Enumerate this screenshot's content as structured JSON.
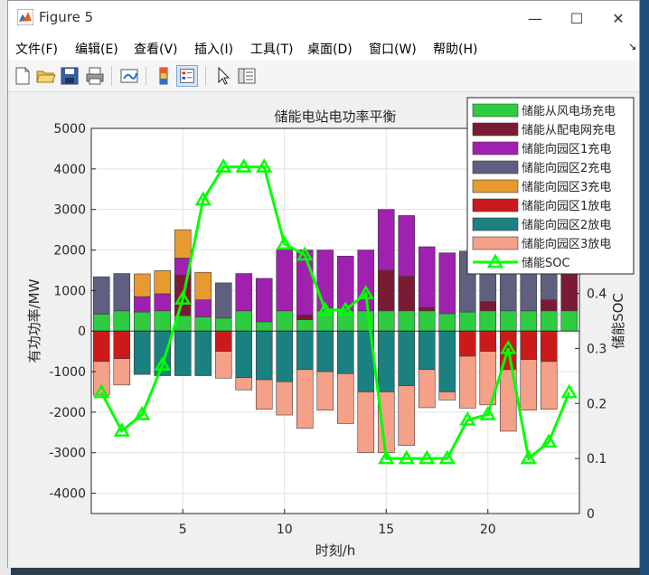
{
  "window": {
    "title": "Figure 5",
    "controls": {
      "minimize": "—",
      "maximize": "☐",
      "close": "✕"
    }
  },
  "menu": [
    {
      "label": "文件(F)"
    },
    {
      "label": "编辑(E)"
    },
    {
      "label": "查看(V)"
    },
    {
      "label": "插入(I)"
    },
    {
      "label": "工具(T)"
    },
    {
      "label": "桌面(D)"
    },
    {
      "label": "窗口(W)"
    },
    {
      "label": "帮助(H)"
    }
  ],
  "menu_arrow": "↘",
  "toolbar": [
    {
      "icon": "new-figure-icon"
    },
    {
      "icon": "open-file-icon"
    },
    {
      "icon": "save-icon"
    },
    {
      "icon": "print-icon"
    },
    {
      "icon": "link-plot-icon"
    },
    {
      "icon": "colorbar-icon"
    },
    {
      "icon": "legend-icon"
    },
    {
      "icon": "pointer-icon"
    },
    {
      "icon": "property-inspector-icon"
    }
  ],
  "chart_data": {
    "type": "bar",
    "title": "储能电站电功率平衡",
    "xlabel": "时刻/h",
    "ylabel": "有功功率/MW",
    "y2label": "储能SOC",
    "xlim": [
      0.5,
      24.5
    ],
    "ylim": [
      -4500,
      5000
    ],
    "y2lim": [
      0,
      0.7
    ],
    "xticks": [
      5,
      10,
      15,
      20
    ],
    "yticks": [
      -4000,
      -3000,
      -2000,
      -1000,
      0,
      1000,
      2000,
      3000,
      4000,
      5000
    ],
    "y2ticks": [
      0,
      0.1,
      0.2,
      0.3,
      0.4,
      0.5,
      0.6
    ],
    "grid": true,
    "legend_position": "top-right",
    "x": [
      1,
      2,
      3,
      4,
      5,
      6,
      7,
      8,
      9,
      10,
      11,
      12,
      13,
      14,
      15,
      16,
      17,
      18,
      19,
      20,
      21,
      22,
      23,
      24
    ],
    "positive_series": [
      {
        "name": "储能从风电场充电",
        "color": "#2ecc40",
        "values": [
          420,
          500,
          470,
          500,
          380,
          350,
          320,
          500,
          230,
          500,
          280,
          500,
          500,
          500,
          500,
          500,
          500,
          430,
          470,
          500,
          500,
          500,
          500,
          500
        ]
      },
      {
        "name": "储能从配电网充电",
        "color": "#7b1a33",
        "values": [
          0,
          0,
          0,
          0,
          1000,
          0,
          0,
          0,
          0,
          0,
          120,
          0,
          0,
          0,
          1000,
          850,
          80,
          0,
          0,
          230,
          0,
          0,
          270,
          1200
        ]
      },
      {
        "name": "储能向园区1充电",
        "color": "#a020b0",
        "values": [
          0,
          0,
          380,
          420,
          420,
          420,
          0,
          920,
          1070,
          1500,
          1600,
          1500,
          1350,
          1500,
          1500,
          1500,
          1500,
          1500,
          0,
          0,
          0,
          0,
          0,
          0
        ]
      },
      {
        "name": "储能向园区2充电",
        "color": "#5f5f7f",
        "values": [
          920,
          920,
          0,
          0,
          0,
          0,
          870,
          0,
          0,
          0,
          0,
          0,
          0,
          0,
          0,
          0,
          0,
          0,
          1500,
          1500,
          1500,
          1500,
          1500,
          1500
        ]
      },
      {
        "name": "储能向园区3充电",
        "color": "#e69a30",
        "values": [
          0,
          0,
          560,
          570,
          700,
          680,
          0,
          0,
          0,
          0,
          0,
          0,
          0,
          0,
          0,
          0,
          0,
          0,
          0,
          0,
          0,
          0,
          0,
          0
        ]
      }
    ],
    "negative_series": [
      {
        "name": "储能向园区1放电",
        "color": "#cc1a1a",
        "values": [
          -750,
          -680,
          0,
          0,
          0,
          0,
          -500,
          0,
          0,
          0,
          0,
          0,
          0,
          0,
          0,
          0,
          0,
          0,
          -620,
          -500,
          -950,
          -700,
          -750,
          0
        ]
      },
      {
        "name": "储能向园区2放电",
        "color": "#1a8080",
        "values": [
          0,
          0,
          -1070,
          -1100,
          -1100,
          -1100,
          0,
          -1150,
          -1200,
          -1250,
          -950,
          -1000,
          -1050,
          -1500,
          -1500,
          -1350,
          -950,
          -1500,
          0,
          0,
          0,
          0,
          0,
          0
        ]
      },
      {
        "name": "储能向园区3放电",
        "color": "#f5a088",
        "values": [
          -830,
          -650,
          0,
          0,
          0,
          0,
          -660,
          -300,
          -730,
          -820,
          -1450,
          -950,
          -1230,
          -1500,
          -1500,
          -1470,
          -940,
          -200,
          -1280,
          -1320,
          -1520,
          -1250,
          -1180,
          0
        ]
      }
    ],
    "soc_series": {
      "name": "储能SOC",
      "color": "#00ff00",
      "values": [
        0.22,
        0.15,
        0.18,
        0.27,
        0.39,
        0.57,
        0.63,
        0.63,
        0.63,
        0.49,
        0.47,
        0.37,
        0.37,
        0.4,
        0.1,
        0.1,
        0.1,
        0.1,
        0.17,
        0.18,
        0.3,
        0.1,
        0.13,
        0.22
      ]
    }
  }
}
